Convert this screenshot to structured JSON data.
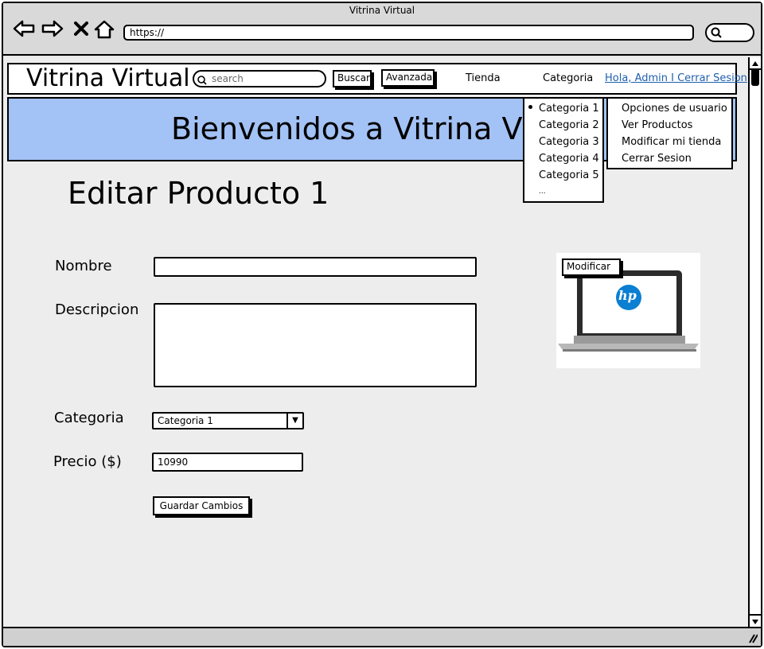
{
  "window": {
    "title": "Vitrina Virtual",
    "url": "https://"
  },
  "nav": {
    "logo": "Vitrina Virtual",
    "search_placeholder": "search",
    "buscar": "Buscar",
    "avanzada": "Avanzada",
    "tienda": "Tienda",
    "categoria": "Categoria",
    "user_link": "Hola, Admin I Cerrar Sesion"
  },
  "banner": {
    "text": "Bienvenidos a Vitrina Virtual"
  },
  "page": {
    "title": "Editar Producto 1"
  },
  "form": {
    "nombre_label": "Nombre",
    "descripcion_label": "Descripcion",
    "categoria_label": "Categoria",
    "categoria_value": "Categoria 1",
    "precio_label": "Precio ($)",
    "precio_value": "10990",
    "save": "Guardar Cambios"
  },
  "image": {
    "modify": "Modificar",
    "brand": "hp"
  },
  "category_menu": {
    "items": [
      "Categoria 1",
      "Categoria 2",
      "Categoria 3",
      "Categoria 4",
      "Categoria 5",
      "..."
    ],
    "selected": 0
  },
  "user_menu": {
    "items": [
      "Opciones de usuario",
      "Ver Productos",
      "Modificar mi tienda",
      "Cerrar Sesion"
    ]
  }
}
